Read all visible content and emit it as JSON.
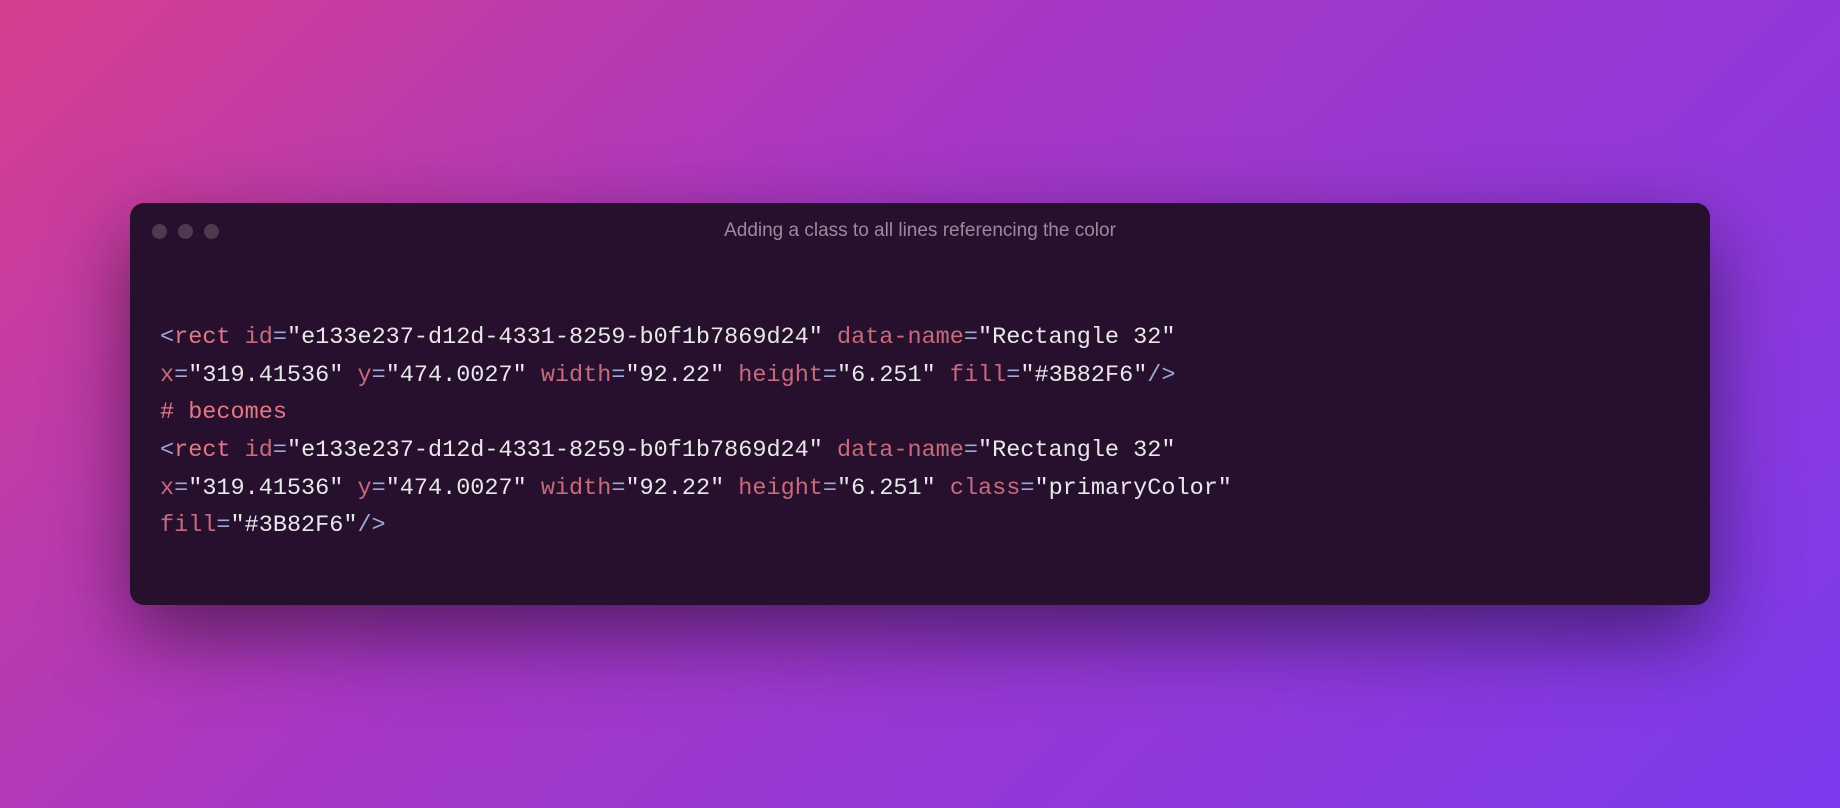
{
  "window": {
    "title": "Adding a class to all lines referencing the color"
  },
  "code": {
    "line1": {
      "open": "<",
      "tag": "rect",
      "sp": " ",
      "attr_id": "id",
      "eq": "=",
      "val_id": "\"e133e237-d12d-4331-8259-b0f1b7869d24\"",
      "attr_dataname": "data-name",
      "val_dataname": "\"Rectangle 32\""
    },
    "line2": {
      "attr_x": "x",
      "eq": "=",
      "val_x": "\"319.41536\"",
      "sp": " ",
      "attr_y": "y",
      "val_y": "\"474.0027\"",
      "attr_width": "width",
      "val_width": "\"92.22\"",
      "attr_height": "height",
      "val_height": "\"6.251\"",
      "attr_fill": "fill",
      "val_fill": "\"#3B82F6\"",
      "close": "/>"
    },
    "comment": "# becomes",
    "line4": {
      "open": "<",
      "tag": "rect",
      "sp": " ",
      "attr_id": "id",
      "eq": "=",
      "val_id": "\"e133e237-d12d-4331-8259-b0f1b7869d24\"",
      "attr_dataname": "data-name",
      "val_dataname": "\"Rectangle 32\""
    },
    "line5": {
      "attr_x": "x",
      "eq": "=",
      "val_x": "\"319.41536\"",
      "sp": " ",
      "attr_y": "y",
      "val_y": "\"474.0027\"",
      "attr_width": "width",
      "val_width": "\"92.22\"",
      "attr_height": "height",
      "val_height": "\"6.251\"",
      "attr_class": "class",
      "val_class": "\"primaryColor\""
    },
    "line6": {
      "attr_fill": "fill",
      "eq": "=",
      "val_fill": "\"#3B82F6\"",
      "close": "/>"
    }
  }
}
